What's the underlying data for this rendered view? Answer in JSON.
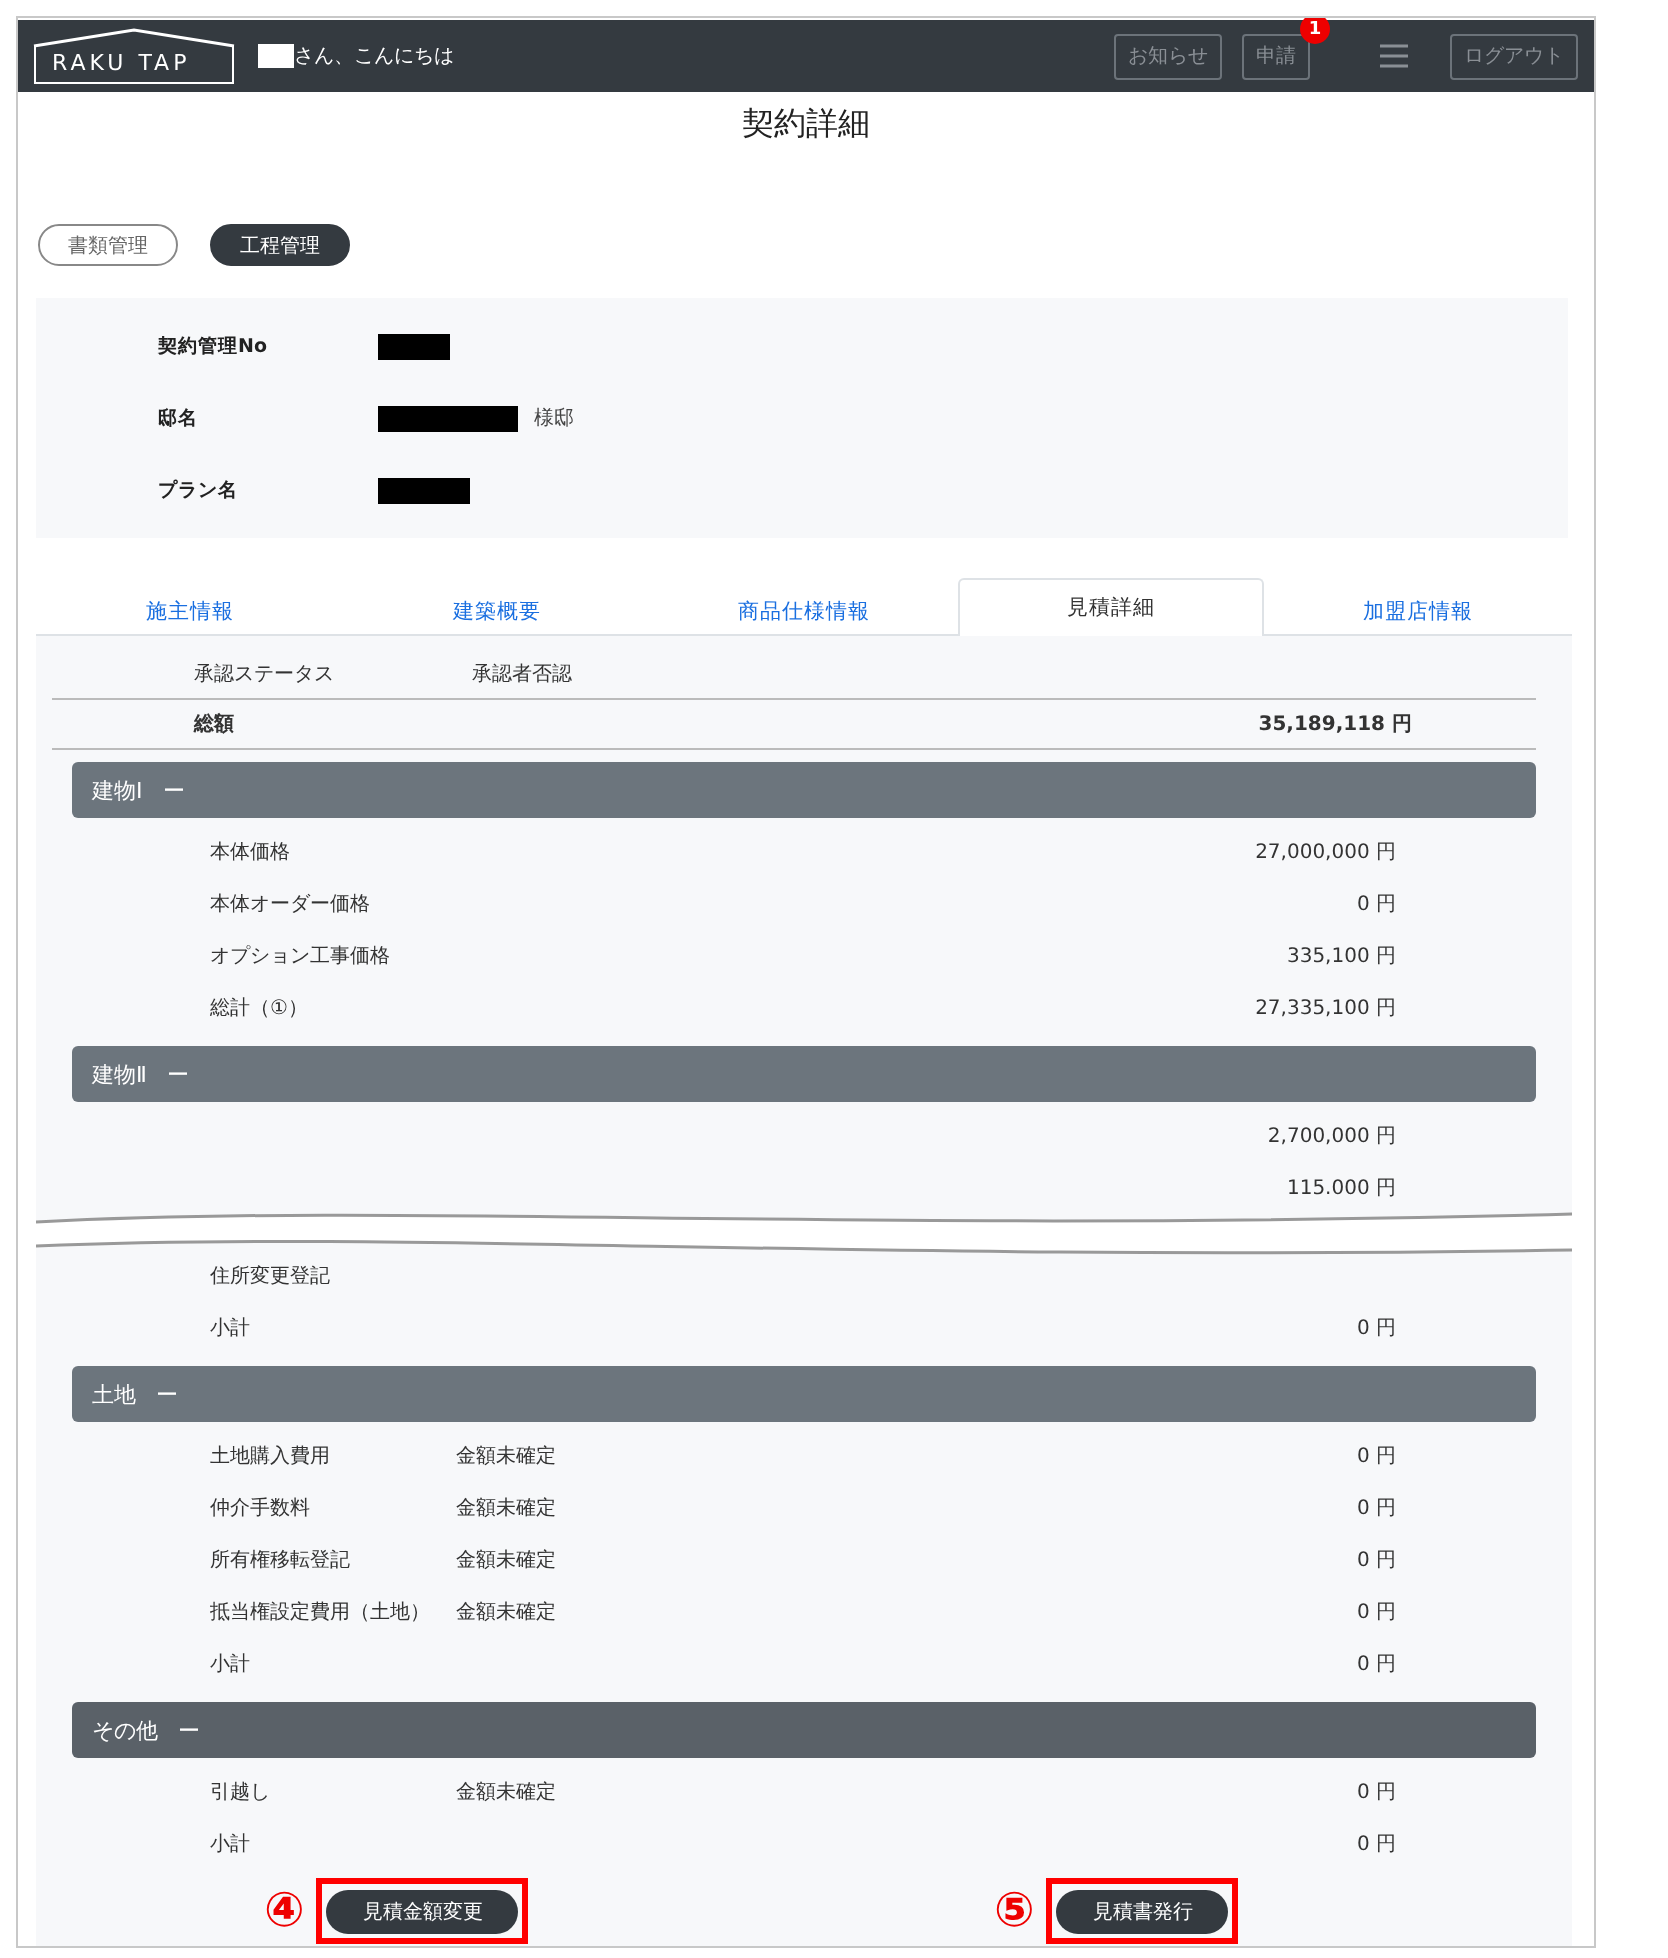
{
  "header": {
    "logo": "RAKU TAP",
    "greeting": "さん、こんにちは",
    "buttons": [
      {
        "label": "お知らせ"
      },
      {
        "label": "申請",
        "badge": "1"
      }
    ],
    "logout": "ログアウト"
  },
  "title": "契約詳細",
  "mode_tabs": [
    {
      "label": "書類管理",
      "selected": false
    },
    {
      "label": "工程管理",
      "selected": true
    }
  ],
  "info": [
    {
      "label": "契約管理No"
    },
    {
      "label": "邸名",
      "suffix": "様邸"
    },
    {
      "label": "プラン名"
    }
  ],
  "tabs": [
    {
      "label": "施主情報",
      "selected": false
    },
    {
      "label": "建築概要",
      "selected": false
    },
    {
      "label": "商品仕様情報",
      "selected": false
    },
    {
      "label": "見積詳細",
      "selected": true
    },
    {
      "label": "加盟店情報",
      "selected": false
    }
  ],
  "summary": [
    {
      "kind": "status",
      "label": "承認ステータス",
      "value": "承認者否認"
    },
    {
      "kind": "total",
      "label": "総額",
      "amount": "35,189,118 円"
    }
  ],
  "sections": [
    {
      "title": "建物Ⅰ",
      "toggle": "ー",
      "highlighted": false,
      "rows": [
        {
          "label": "本体価格",
          "amount": "27,000,000 円"
        },
        {
          "label": "本体オーダー価格",
          "amount": "0 円"
        },
        {
          "label": "オプション工事価格",
          "amount": "335,100 円"
        },
        {
          "label": "総計（①）",
          "amount": "27,335,100 円"
        }
      ]
    },
    {
      "title": "建物Ⅱ",
      "toggle": "ー",
      "highlighted": false,
      "rows": [
        {
          "amount": "2,700,000 円"
        },
        {
          "amount": "115.000 円"
        },
        {
          "kind": "break"
        },
        {
          "label": "住所変更登記"
        },
        {
          "label": "小計",
          "amount": "0 円"
        }
      ]
    },
    {
      "title": "土地",
      "toggle": "ー",
      "highlighted": false,
      "rows": [
        {
          "label": "土地購入費用",
          "note": "金額未確定",
          "amount": "0 円"
        },
        {
          "label": "仲介手数料",
          "note": "金額未確定",
          "amount": "0 円"
        },
        {
          "label": "所有権移転登記",
          "note": "金額未確定",
          "amount": "0 円"
        },
        {
          "label": "抵当権設定費用（土地）",
          "note": "金額未確定",
          "amount": "0 円"
        },
        {
          "label": "小計",
          "amount": "0 円"
        }
      ]
    },
    {
      "title": "その他",
      "toggle": "ー",
      "highlighted": true,
      "rows": [
        {
          "label": "引越し",
          "note": "金額未確定",
          "amount": "0 円"
        },
        {
          "label": "小計",
          "amount": "0 円"
        }
      ]
    }
  ],
  "actions": [
    {
      "marker": "④",
      "label": "見積金額変更",
      "highlighted": true
    },
    {
      "marker": "⑤",
      "label": "見積書発行",
      "highlighted": true
    }
  ]
}
